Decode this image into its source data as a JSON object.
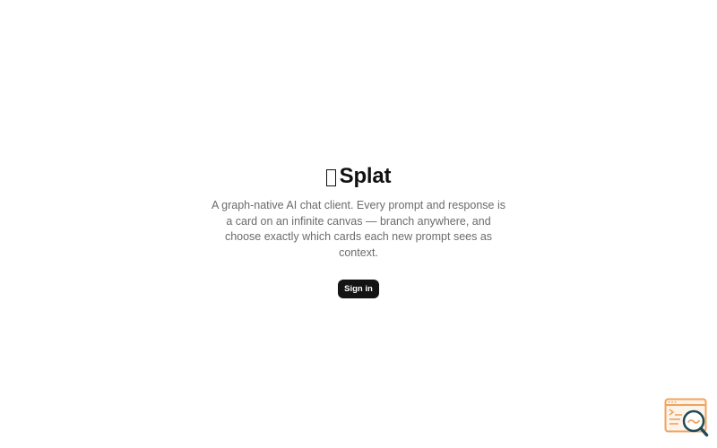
{
  "brand": {
    "name": "Splat",
    "logo_icon": "box-glyph-icon"
  },
  "hero": {
    "tagline": "A graph-native AI chat client. Every prompt and response is a card on an infinite canvas — branch anywhere, and choose exactly which cards each new prompt sees as context."
  },
  "actions": {
    "sign_in_label": "Sign in"
  },
  "widget": {
    "icon": "window-search-icon",
    "accent": "#f0a35e",
    "dark": "#1f4a57"
  },
  "colors": {
    "background": "#ffffff",
    "text": "#111111",
    "muted_text": "#6b6b6b",
    "button_bg": "#141414",
    "button_text": "#ffffff"
  }
}
